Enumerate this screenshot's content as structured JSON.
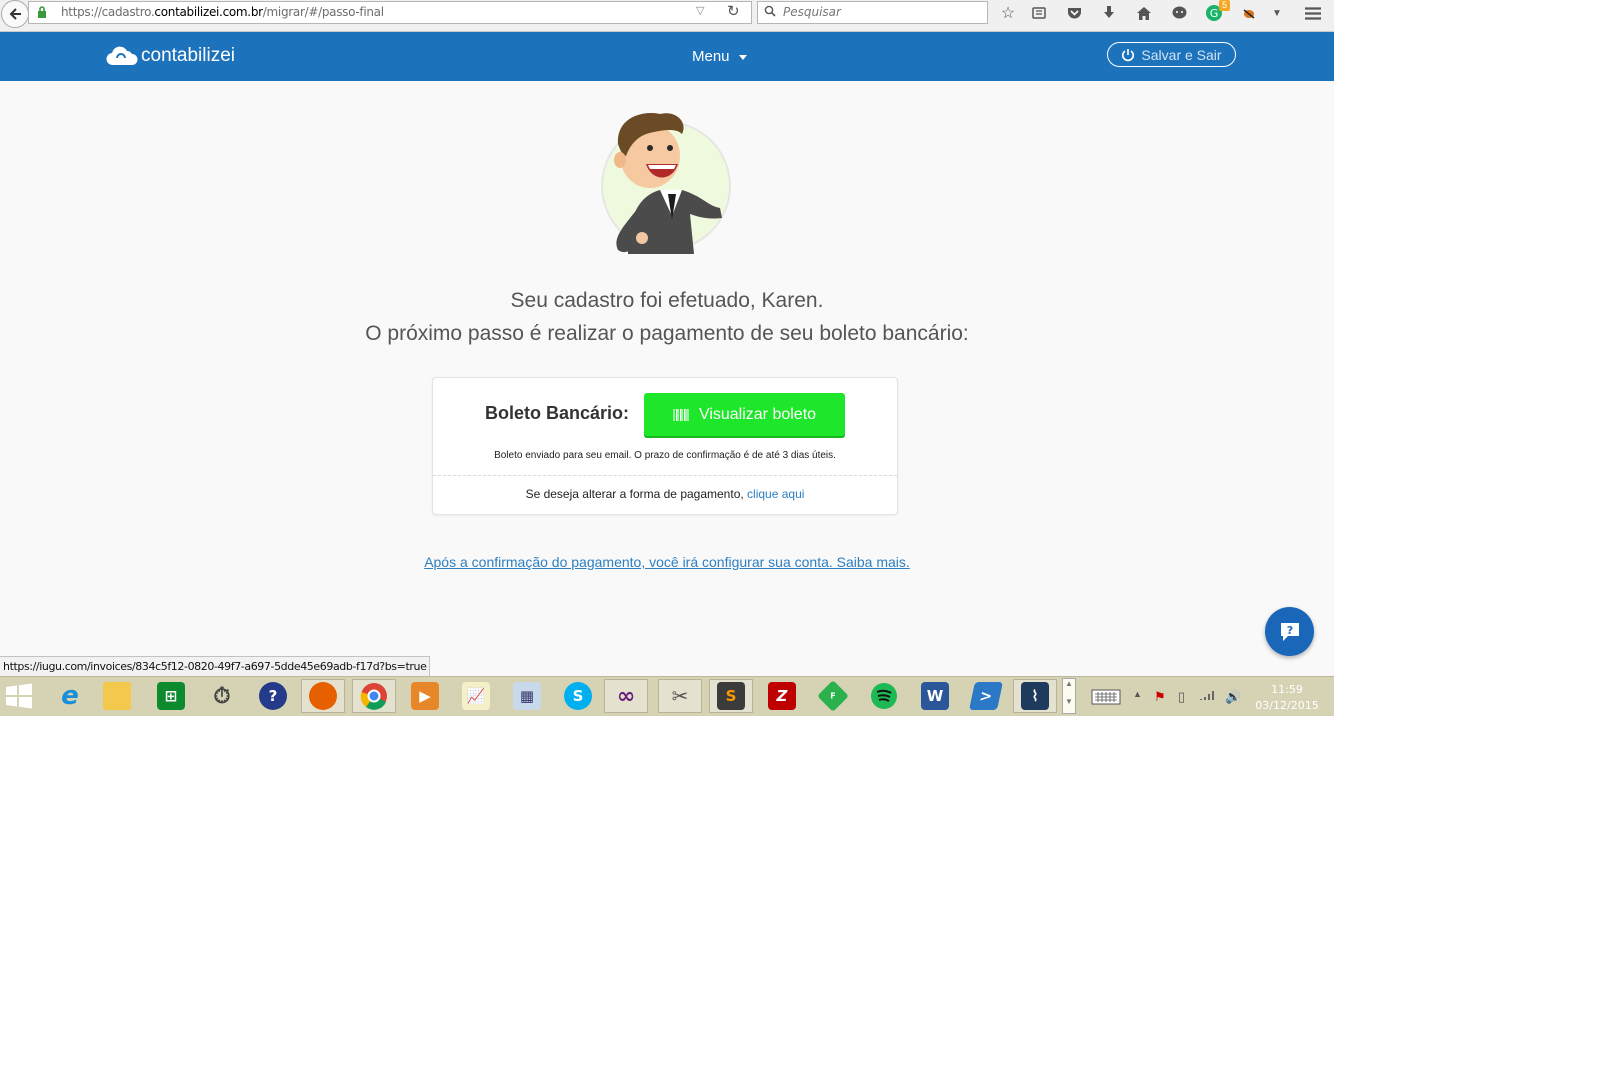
{
  "browser": {
    "url_prefix": "https://cadastro.",
    "url_domain": "contabilizei.com.br",
    "url_path": "/migrar/#/passo-final",
    "search_placeholder": "Pesquisar",
    "badge_count": "5"
  },
  "header": {
    "logo_text": "contabilizei",
    "menu_label": "Menu",
    "save_exit_label": "Salvar e Sair"
  },
  "main": {
    "heading_line1": "Seu cadastro foi efetuado, Karen.",
    "heading_line2": "O próximo passo é realizar o pagamento de seu boleto bancário:",
    "card": {
      "label": "Boleto Bancário:",
      "button_label": "Visualizar boleto",
      "note": "Boleto enviado para seu email. O prazo de confirmação é de até 3 dias úteis.",
      "change_text": "Se deseja alterar a forma de pagamento,",
      "change_link": "clique aqui"
    },
    "info_link": "Após a confirmação do pagamento, você irá configurar sua conta. Saiba mais."
  },
  "status_url": "https://iugu.com/invoices/834c5f12-0820-49f7-a697-5dde45e69adb-f17d?bs=true",
  "taskbar": {
    "clock_time": "11:59",
    "clock_date": "03/12/2015",
    "apps": [
      "windows-start",
      "internet-explorer",
      "file-explorer",
      "store",
      "stopwatch",
      "help",
      "firefox",
      "chrome",
      "media-player",
      "chart-tool",
      "calculator",
      "skype",
      "visual-studio",
      "tools",
      "sublime-text",
      "filezilla",
      "feedly",
      "spotify",
      "word",
      "powershell",
      "mysql-workbench"
    ]
  },
  "colors": {
    "header_blue": "#1d72bc",
    "button_green": "#1ee62a",
    "link_blue": "#2d7fc2",
    "help_blue": "#1a66b8"
  }
}
